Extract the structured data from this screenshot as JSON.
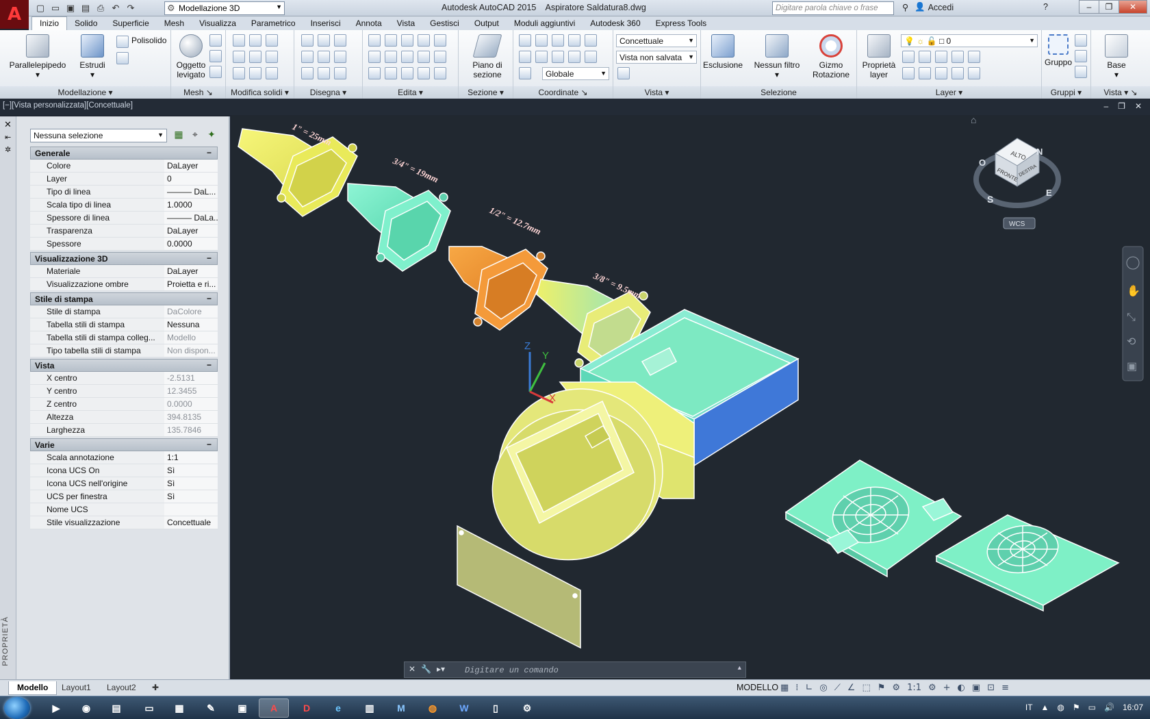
{
  "titlebar": {
    "workspace": "Modellazione 3D",
    "app_title": "Autodesk AutoCAD 2015    Aspiratore Saldatura8.dwg",
    "search_placeholder": "Digitare parola chiave o frase",
    "signin": "Accedi",
    "help": "?"
  },
  "ribbon_tabs": [
    "Inizio",
    "Solido",
    "Superficie",
    "Mesh",
    "Visualizza",
    "Parametrico",
    "Inserisci",
    "Annota",
    "Vista",
    "Gestisci",
    "Output",
    "Moduli aggiuntivi",
    "Autodesk 360",
    "Express Tools"
  ],
  "ribbon": {
    "modellazione": {
      "title": "Modellazione",
      "parallelepipedo": "Parallelepipedo",
      "estrudi": "Estrudi",
      "polisolido": "Polisolido"
    },
    "mesh": {
      "title": "Mesh",
      "oggetto": "Oggetto",
      "levigato": "levigato"
    },
    "modifica": {
      "title": "Modifica solidi"
    },
    "disegna": {
      "title": "Disegna"
    },
    "edita": {
      "title": "Edita"
    },
    "sezione": {
      "title": "Sezione",
      "piano": "Piano di",
      "sezione": "sezione"
    },
    "coordinate": {
      "title": "Coordinate",
      "globale": "Globale"
    },
    "vista": {
      "title": "Vista",
      "stile": "Concettuale",
      "vista_sel": "Vista non salvata"
    },
    "selezione": {
      "title": "Selezione",
      "esclusione": "Esclusione",
      "filtro": "Nessun filtro",
      "gizmo1": "Gizmo",
      "gizmo2": "Rotazione"
    },
    "layer": {
      "title": "Layer",
      "prop1": "Proprietà",
      "prop2": "layer",
      "layer_sel": "0"
    },
    "gruppi": {
      "title": "Gruppi",
      "gruppo": "Gruppo"
    },
    "vistap": {
      "title": "Vista",
      "base": "Base"
    }
  },
  "viewport_label": "[−][Vista personalizzata][Concettuale]",
  "properties": {
    "selection": "Nessuna selezione",
    "strip_label": "PROPRIETÀ",
    "sections": [
      {
        "title": "Generale",
        "rows": [
          {
            "k": "Colore",
            "v": "DaLayer"
          },
          {
            "k": "Layer",
            "v": "0"
          },
          {
            "k": "Tipo di linea",
            "v": "——— DaL..."
          },
          {
            "k": "Scala tipo di linea",
            "v": "1.0000"
          },
          {
            "k": "Spessore di linea",
            "v": "——— DaLa..."
          },
          {
            "k": "Trasparenza",
            "v": "DaLayer"
          },
          {
            "k": "Spessore",
            "v": "0.0000"
          }
        ]
      },
      {
        "title": "Visualizzazione 3D",
        "rows": [
          {
            "k": "Materiale",
            "v": "DaLayer"
          },
          {
            "k": "Visualizzazione ombre",
            "v": "Proietta e ri..."
          }
        ]
      },
      {
        "title": "Stile di stampa",
        "rows": [
          {
            "k": "Stile di stampa",
            "v": "DaColore",
            "grey": true
          },
          {
            "k": "Tabella stili di stampa",
            "v": "Nessuna"
          },
          {
            "k": "Tabella stili di stampa colleg...",
            "v": "Modello",
            "grey": true
          },
          {
            "k": "Tipo tabella stili di stampa",
            "v": "Non dispon...",
            "grey": true
          }
        ]
      },
      {
        "title": "Vista",
        "rows": [
          {
            "k": "X centro",
            "v": "-2.5131",
            "grey": true
          },
          {
            "k": "Y centro",
            "v": "12.3455",
            "grey": true
          },
          {
            "k": "Z centro",
            "v": "0.0000",
            "grey": true
          },
          {
            "k": "Altezza",
            "v": "394.8135",
            "grey": true
          },
          {
            "k": "Larghezza",
            "v": "135.7846",
            "grey": true
          }
        ]
      },
      {
        "title": "Varie",
        "rows": [
          {
            "k": "Scala annotazione",
            "v": "1:1"
          },
          {
            "k": "Icona UCS On",
            "v": "Sì"
          },
          {
            "k": "Icona UCS nell'origine",
            "v": "Sì"
          },
          {
            "k": "UCS per finestra",
            "v": "Sì"
          },
          {
            "k": "Nome UCS",
            "v": ""
          },
          {
            "k": "Stile visualizzazione",
            "v": "Concettuale"
          }
        ]
      }
    ]
  },
  "viewcube": {
    "top": "ALTO",
    "front": "FRONTE",
    "right": "DESTRA",
    "n": "N",
    "s": "S",
    "e": "E",
    "o": "O",
    "wcs": "WCS"
  },
  "model_labels": [
    "1\" = 25mm",
    "3/4\" = 19mm",
    "1/2\" = 12.7mm",
    "3/8\" = 9.5mm"
  ],
  "ucs": {
    "x": "X",
    "y": "Y",
    "z": "Z"
  },
  "command": {
    "placeholder": "Digitare un comando"
  },
  "status": {
    "tabs": [
      "Modello",
      "Layout1",
      "Layout2"
    ],
    "model": "MODELLO",
    "scale": "1:1"
  },
  "taskbar": {
    "lang": "IT",
    "time": "16:07"
  },
  "colors": {
    "yellow": "#eef06a",
    "cyan": "#7be8c0",
    "orange": "#f0973a",
    "blue": "#3f78d8",
    "bg": "#212830"
  }
}
